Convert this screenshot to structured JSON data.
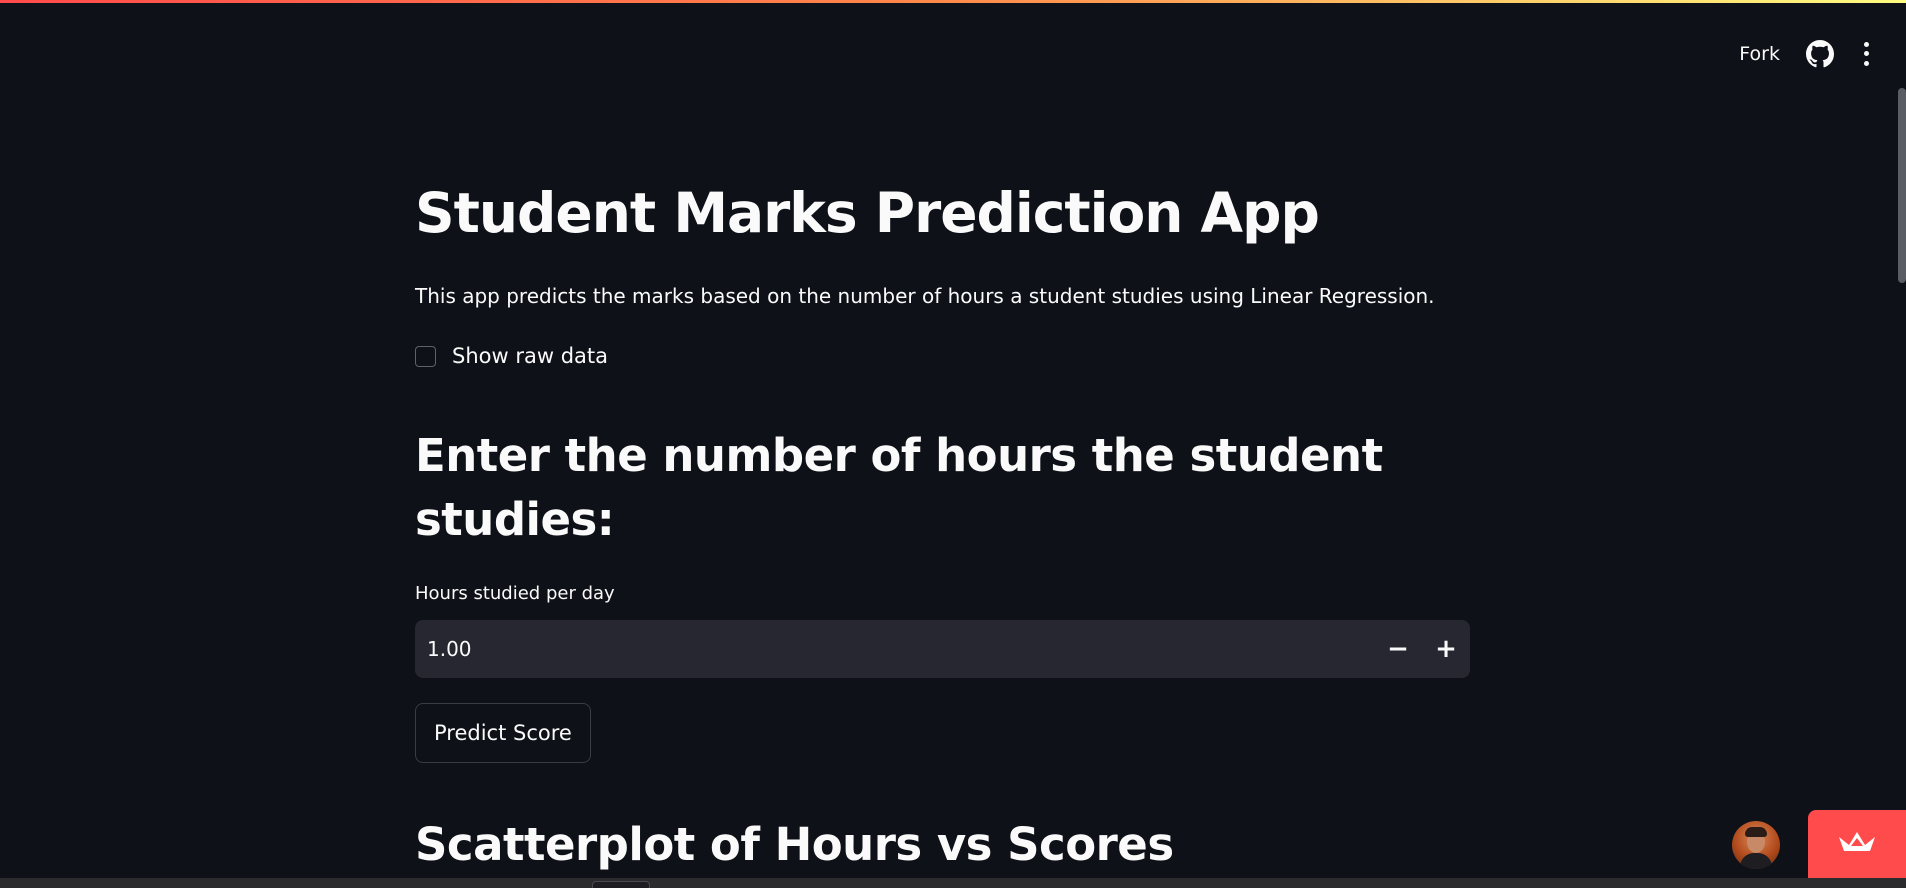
{
  "header": {
    "fork_label": "Fork",
    "github_icon": "github-icon",
    "menu_icon": "more-vertical-icon"
  },
  "main": {
    "title": "Student Marks Prediction App",
    "description": "This app predicts the marks based on the number of hours a student studies using Linear Regression.",
    "show_raw_checkbox": {
      "label": "Show raw data",
      "checked": false
    },
    "input_heading": "Enter the number of hours the student studies:",
    "hours_input": {
      "label": "Hours studied per day",
      "value": "1.00",
      "decrement_symbol": "−",
      "increment_symbol": "+"
    },
    "predict_button_label": "Predict Score",
    "scatter_heading": "Scatterplot of Hours vs Scores"
  },
  "floating": {
    "avatar_icon": "user-avatar",
    "deploy_icon": "streamlit-crown-icon"
  },
  "colors": {
    "background": "#0e1117",
    "input_background": "#262730",
    "accent": "#ff4b4b",
    "text": "#fafafa"
  }
}
